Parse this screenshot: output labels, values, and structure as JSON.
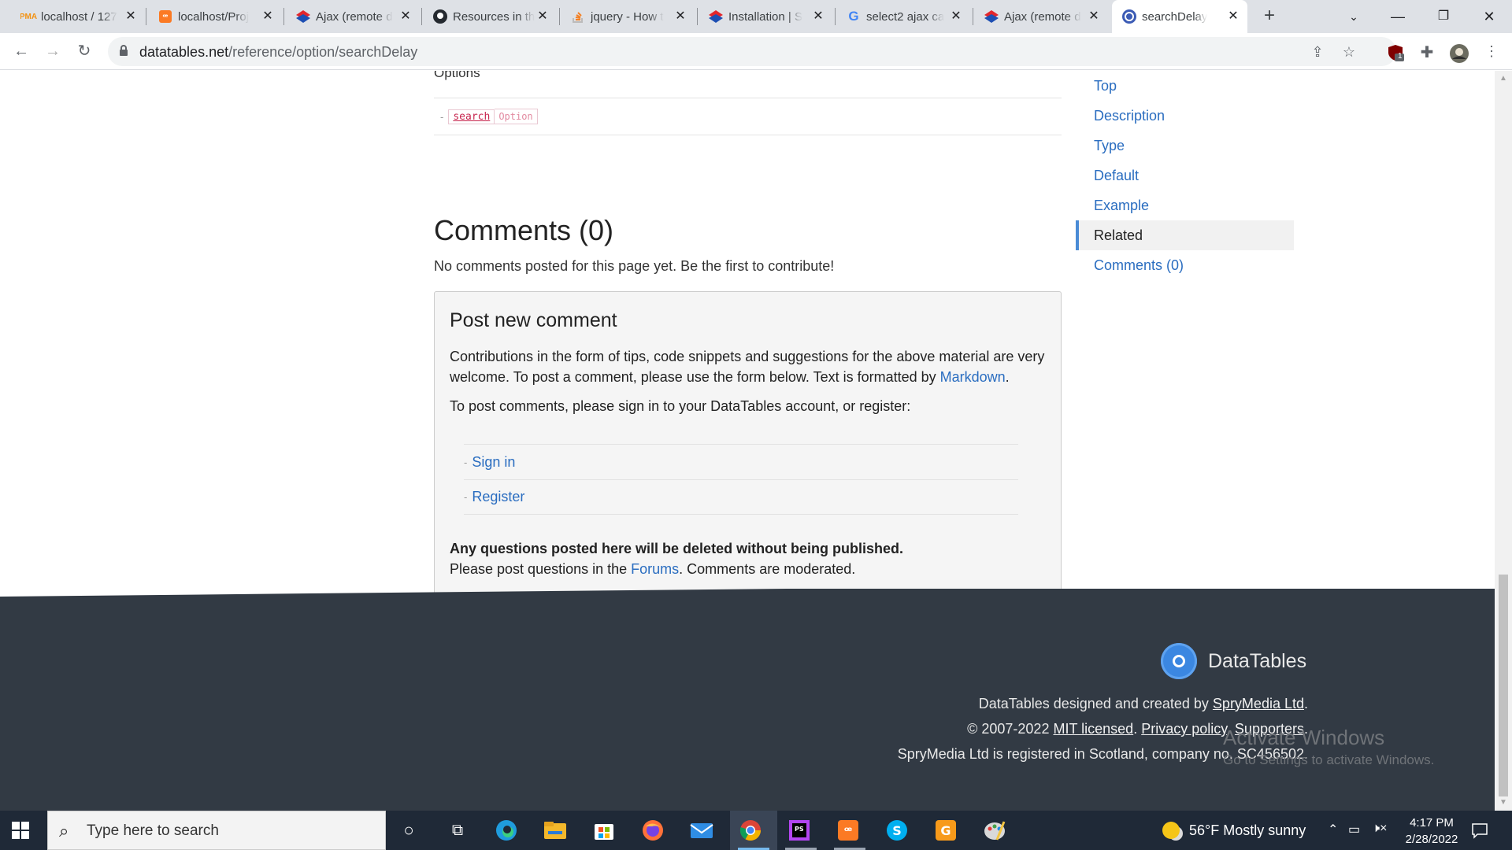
{
  "browser": {
    "tabs": [
      {
        "label": "localhost / 127",
        "icon": "phpmyadmin-icon"
      },
      {
        "label": "localhost/Proj",
        "icon": "xampp-icon"
      },
      {
        "label": "Ajax (remote d",
        "icon": "select2-icon"
      },
      {
        "label": "Resources in th",
        "icon": "github-icon"
      },
      {
        "label": "jquery - How t",
        "icon": "stackoverflow-icon"
      },
      {
        "label": "Installation | S",
        "icon": "select2-icon"
      },
      {
        "label": "select2 ajax ca",
        "icon": "google-icon"
      },
      {
        "label": "Ajax (remote d",
        "icon": "select2-icon"
      },
      {
        "label": "searchDelay",
        "icon": "datatables-icon"
      }
    ],
    "url_domain": "datatables.net",
    "url_path": "/reference/option/searchDelay",
    "extension_badge": "1"
  },
  "content": {
    "options_heading": "Options",
    "related_option": {
      "name": "search",
      "type": "Option"
    },
    "comments_title": "Comments (0)",
    "comments_intro": "No comments posted for this page yet. Be the first to contribute!",
    "post": {
      "title": "Post new comment",
      "para1_a": "Contributions in the form of tips, code snippets and suggestions for the above material are very welcome. To post a comment, please use the form below. Text is formatted by ",
      "para1_link": "Markdown",
      "para1_b": ".",
      "para2": "To post comments, please sign in to your DataTables account, or register:",
      "links": [
        "Sign in",
        "Register"
      ],
      "warning_bold": "Any questions posted here will be deleted without being published.",
      "warning_a": "Please post questions in the ",
      "warning_link": "Forums",
      "warning_b": ". Comments are moderated."
    }
  },
  "sidenav": {
    "items": [
      "Top",
      "Description",
      "Type",
      "Default",
      "Example",
      "Related",
      "Comments (0)"
    ],
    "active": "Related"
  },
  "footer": {
    "logo_text": "DataTables",
    "line1_a": "DataTables designed and created by ",
    "line1_link": "SpryMedia Ltd",
    "line1_b": ".",
    "line2_a": "© 2007-2022 ",
    "line2_link1": "MIT licensed",
    "line2_sep1": ". ",
    "line2_link2": "Privacy policy",
    "line2_sep2": ". ",
    "line2_link3": "Supporters",
    "line2_b": ".",
    "line3": "SpryMedia Ltd is registered in Scotland, company no. SC456502.",
    "watermark_title": "Activate Windows",
    "watermark_sub": "Go to Settings to activate Windows."
  },
  "taskbar": {
    "search_placeholder": "Type here to search",
    "weather": "56°F  Mostly sunny",
    "time": "4:17 PM",
    "date": "2/28/2022"
  },
  "colors": {
    "link": "#2a6dc0",
    "footer_bg": "#323a44",
    "taskbar_bg": "#1f2937",
    "nav_active_bar": "#4a8bd6"
  }
}
